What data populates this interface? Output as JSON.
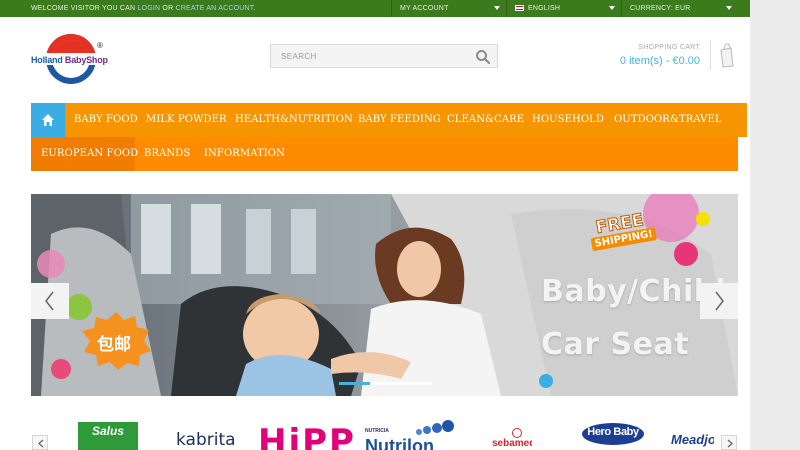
{
  "topbar": {
    "welcome_text": "WELCOME VISITOR YOU CAN",
    "login_link": "LOGIN",
    "or_text": "OR",
    "create_account_link": "CREATE AN ACCOUNT",
    "period": ".",
    "my_account": "MY ACCOUNT",
    "language": "ENGLISH",
    "currency": "CURRENCY: EUR"
  },
  "logo": {
    "word1": "Holland",
    "word2": "BabyShop",
    "registered": "®"
  },
  "search": {
    "placeholder": "SEARCH",
    "icon": "search-icon"
  },
  "cart": {
    "label": "SHOPPING CART",
    "summary": "0 item(s) - €0.00",
    "icon": "shopping-bag-icon"
  },
  "nav": {
    "home_icon": "home-icon",
    "row1": [
      "BABY FOOD",
      "MILK POWDER",
      "HEALTH&NUTRITION",
      "BABY FEEDING",
      "CLEAN&CARE",
      "HOUSEHOLD",
      "OUTDOOR&TRAVEL"
    ],
    "row2": [
      "EUROPEAN FOOD",
      "BRANDS",
      "INFORMATION"
    ]
  },
  "slider": {
    "line1": "Baby/Child",
    "line2": "Car Seat",
    "badge_free": "FREE",
    "badge_shipping": "SHIPPING!",
    "badge_cn": "包邮",
    "prev_icon": "chevron-left-icon",
    "next_icon": "chevron-right-icon",
    "active_slide": 1,
    "slide_count": 3
  },
  "brands": {
    "items": [
      "Salus",
      "kabrita",
      "HiPP",
      "Nutrilon",
      "sebamed",
      "Hero Baby",
      "Meadjohnson"
    ],
    "nutricia": "NUTRICIA"
  },
  "colors": {
    "topbar": "#3c7a1e",
    "nav": "#ff8c00",
    "home": "#3aaee4",
    "accent": "#49b1dd"
  }
}
